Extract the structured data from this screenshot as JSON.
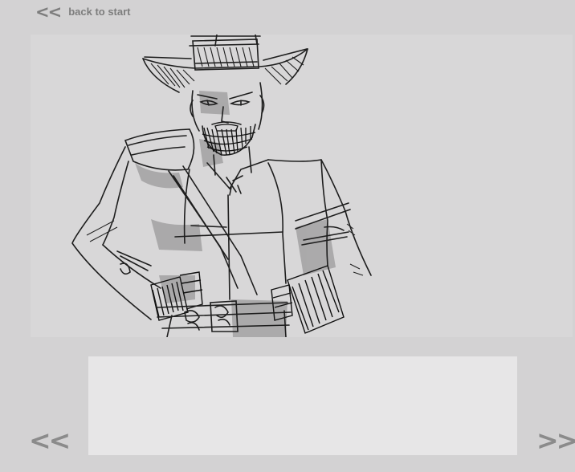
{
  "header": {
    "back_arrows": "<<",
    "back_label": "back to start"
  },
  "panel": {
    "illustration": "sketch of cowboy with hat, beard, bandolier, hands on hips"
  },
  "caption": {
    "text": ""
  },
  "navigation": {
    "prev_label": "<<",
    "next_label": ">>"
  },
  "colors": {
    "background": "#d3d2d3",
    "panel": "#d8d7d8",
    "caption_box": "#e7e6e7",
    "nav_text": "#8b8b8b",
    "sketch_line": "#1e1e1e",
    "sketch_shade": "#9a999a"
  }
}
